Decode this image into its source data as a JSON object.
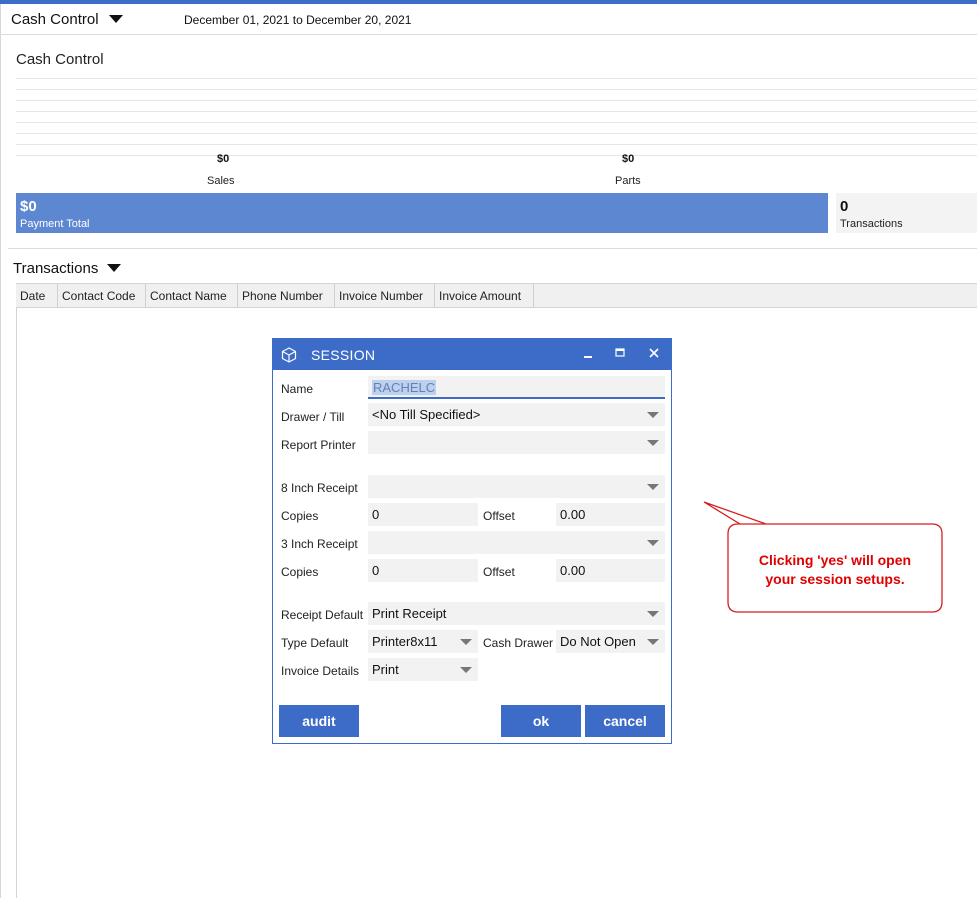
{
  "header": {
    "title": "Cash Control",
    "date_range": "December 01, 2021 to December 20, 2021"
  },
  "cash_control": {
    "section_title": "Cash Control",
    "stats": [
      {
        "value": "$0",
        "label": "Sales"
      },
      {
        "value": "$0",
        "label": "Parts"
      }
    ],
    "payment_total": {
      "value": "$0",
      "label": "Payment Total"
    },
    "transactions_count": {
      "value": "0",
      "label": "Transactions"
    }
  },
  "transactions": {
    "title": "Transactions",
    "columns": [
      "Date",
      "Contact Code",
      "Contact Name",
      "Phone Number",
      "Invoice Number",
      "Invoice Amount"
    ]
  },
  "session_dialog": {
    "title": "SESSION",
    "icons": {
      "app": "cube-icon",
      "minimize": "minimize-icon",
      "maximize": "maximize-icon",
      "close": "close-icon"
    },
    "fields": {
      "name": {
        "label": "Name",
        "value": "RACHELC"
      },
      "drawer_till": {
        "label": "Drawer / Till",
        "value": "<No Till Specified>"
      },
      "report_printer": {
        "label": "Report Printer",
        "value": ""
      },
      "receipt_8in": {
        "label": "8 Inch Receipt",
        "value": ""
      },
      "copies_8in": {
        "label": "Copies",
        "value": "0"
      },
      "offset_8in": {
        "label": "Offset",
        "value": "0.00"
      },
      "receipt_3in": {
        "label": "3 Inch Receipt",
        "value": ""
      },
      "copies_3in": {
        "label": "Copies",
        "value": "0"
      },
      "offset_3in": {
        "label": "Offset",
        "value": "0.00"
      },
      "receipt_default": {
        "label": "Receipt Default",
        "value": "Print Receipt"
      },
      "type_default": {
        "label": "Type Default",
        "value": "Printer8x11"
      },
      "cash_drawer": {
        "label": "Cash Drawer",
        "value": "Do Not Open"
      },
      "invoice_details": {
        "label": "Invoice Details",
        "value": "Print"
      }
    },
    "buttons": {
      "audit": "audit",
      "ok": "ok",
      "cancel": "cancel"
    }
  },
  "callout": {
    "line1": "Clicking 'yes' will open",
    "line2": "your session setups.",
    "color": "#e00000"
  },
  "colors": {
    "accent": "#3c6cc8",
    "payment_bar": "#5e87d1"
  }
}
